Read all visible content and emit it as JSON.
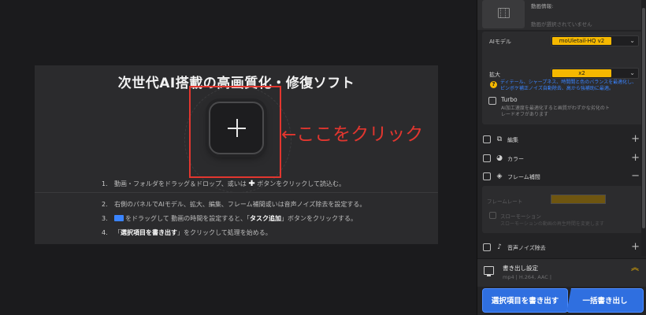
{
  "workspace": {
    "title": "次世代AI搭載の高画質化・修復ソフト",
    "steps": [
      {
        "num": "1.",
        "pre": "動画・フォルダをドラッグ＆ドロップ、或いは",
        "mid": "ボタンをクリックして読込む。"
      },
      {
        "num": "2.",
        "text": "右側のパネルでAIモデル、拡大、編集、フレーム補間或いは音声ノイズ除去を設定する。"
      },
      {
        "num": "3.",
        "pre": "をドラッグして 動画の時間を設定すると、「",
        "bold": "タスク追加",
        "post": "」ボタンをクリックする。"
      },
      {
        "num": "4.",
        "pre": "「",
        "bold": "選択項目を書き出す",
        "post": "」をクリックして処理を始める。"
      }
    ]
  },
  "annotation": {
    "hint": "←ここをクリック",
    "color": "#e2362f"
  },
  "panel": {
    "video_info_label": "動画情報:",
    "video_info_empty": "動画が選択されていません",
    "ai_model_label": "AIモデル",
    "ai_model_value": "moUletail-HQ v2",
    "model_note": "ディテール、シャープネス、時間間と色のバランスを最適化し、ピンボケ補正ノイズ自動除去、高から強補助に最適。",
    "scale_label": "拡大",
    "scale_value": "x2",
    "turbo_label": "Turbo",
    "turbo_desc": "AI加工速度を最適化すると画質がわずかな劣化のトレードオフがあります",
    "rows": {
      "edit": "編集",
      "color": "カラー",
      "frame": "フレーム補間",
      "noise": "音声ノイズ除去"
    },
    "frame_rate_label": "フレームレート",
    "slowmo_label": "スローモーション",
    "slowmo_desc": "スローモーションの動画の再生時間を変更します",
    "export_title": "書き出し設定",
    "export_format": "mp4 | H.264, AAC |",
    "export_selected": "選択項目を書き出す",
    "export_all": "一括書き出し"
  },
  "colors": {
    "accent_yellow": "#f5b800",
    "button_blue": "#2f6fe0",
    "note_blue": "#3a84ff"
  }
}
